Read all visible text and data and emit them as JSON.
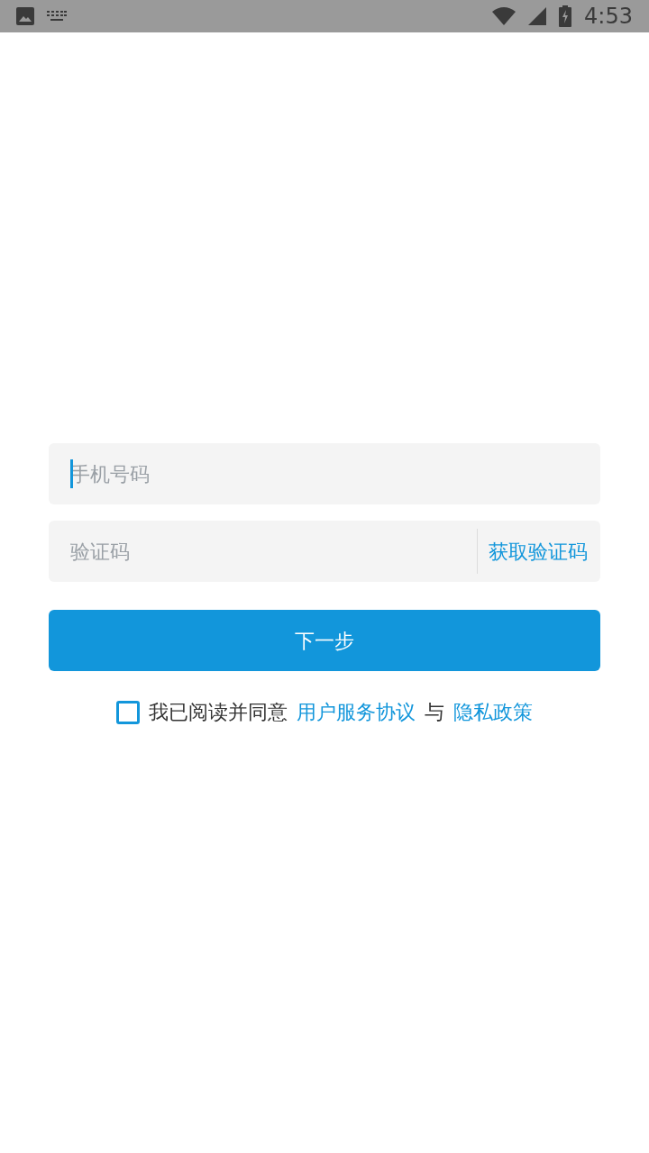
{
  "status_bar": {
    "time": "4:53"
  },
  "phone_field": {
    "placeholder": "手机号码",
    "focused": true
  },
  "code_field": {
    "placeholder": "验证码",
    "action": "获取验证码"
  },
  "next_button": {
    "label": "下一步"
  },
  "agreement": {
    "checked": false,
    "text": "我已阅读并同意",
    "link_1": "用户服务协议",
    "joiner": "与",
    "link_2": "隐私政策"
  }
}
